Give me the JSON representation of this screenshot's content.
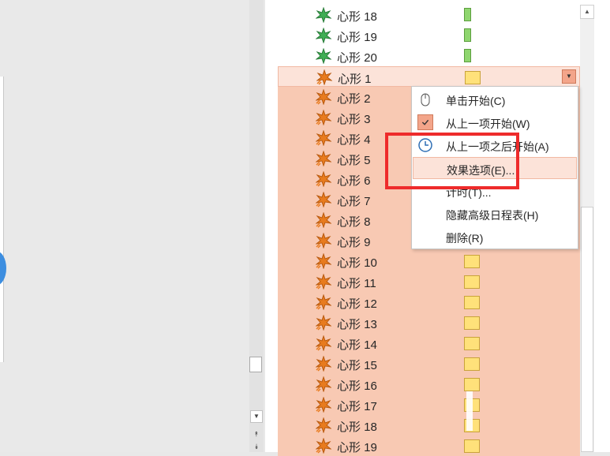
{
  "animations": [
    {
      "label": "心形 18",
      "effect": "emphasis",
      "bar": "green",
      "state": "normal"
    },
    {
      "label": "心形 19",
      "effect": "emphasis",
      "bar": "green",
      "state": "normal"
    },
    {
      "label": "心形 20",
      "effect": "emphasis",
      "bar": "green",
      "state": "normal"
    },
    {
      "label": "心形 1",
      "effect": "entrance",
      "bar": "yellow",
      "state": "selected-first"
    },
    {
      "label": "心形 2",
      "effect": "entrance",
      "bar": "none",
      "state": "selected"
    },
    {
      "label": "心形 3",
      "effect": "entrance",
      "bar": "none",
      "state": "selected"
    },
    {
      "label": "心形 4",
      "effect": "entrance",
      "bar": "none",
      "state": "selected"
    },
    {
      "label": "心形 5",
      "effect": "entrance",
      "bar": "none",
      "state": "selected"
    },
    {
      "label": "心形 6",
      "effect": "entrance",
      "bar": "none",
      "state": "selected"
    },
    {
      "label": "心形 7",
      "effect": "entrance",
      "bar": "none",
      "state": "selected"
    },
    {
      "label": "心形 8",
      "effect": "entrance",
      "bar": "none",
      "state": "selected"
    },
    {
      "label": "心形 9",
      "effect": "entrance",
      "bar": "none",
      "state": "selected"
    },
    {
      "label": "心形 10",
      "effect": "entrance",
      "bar": "yellow",
      "state": "selected"
    },
    {
      "label": "心形 11",
      "effect": "entrance",
      "bar": "yellow",
      "state": "selected"
    },
    {
      "label": "心形 12",
      "effect": "entrance",
      "bar": "yellow",
      "state": "selected"
    },
    {
      "label": "心形 13",
      "effect": "entrance",
      "bar": "yellow",
      "state": "selected"
    },
    {
      "label": "心形 14",
      "effect": "entrance",
      "bar": "yellow",
      "state": "selected"
    },
    {
      "label": "心形 15",
      "effect": "entrance",
      "bar": "yellow",
      "state": "selected"
    },
    {
      "label": "心形 16",
      "effect": "entrance",
      "bar": "yellow",
      "state": "selected"
    },
    {
      "label": "心形 17",
      "effect": "entrance",
      "bar": "yellow",
      "state": "selected"
    },
    {
      "label": "心形 18",
      "effect": "entrance",
      "bar": "yellow",
      "state": "selected"
    },
    {
      "label": "心形 19",
      "effect": "entrance",
      "bar": "yellow",
      "state": "selected"
    }
  ],
  "context_menu": {
    "items": [
      {
        "label": "单击开始(C)",
        "icon": "mouse-icon",
        "checked": false,
        "hover": false
      },
      {
        "label": "从上一项开始(W)",
        "icon": "check-icon",
        "checked": true,
        "hover": false
      },
      {
        "label": "从上一项之后开始(A)",
        "icon": "clock-icon",
        "checked": false,
        "hover": false
      },
      {
        "label": "效果选项(E)...",
        "icon": "",
        "checked": false,
        "hover": true
      },
      {
        "label": "计时(T)...",
        "icon": "",
        "checked": false,
        "hover": false
      },
      {
        "label": "隐藏高级日程表(H)",
        "icon": "",
        "checked": false,
        "hover": false
      },
      {
        "label": "删除(R)",
        "icon": "",
        "checked": false,
        "hover": false
      }
    ]
  },
  "colors": {
    "selection": "#f8c9b3",
    "emphasis_icon": "#3fae54",
    "entrance_icon": "#e87b1e",
    "annotation": "#ee2b2b"
  }
}
